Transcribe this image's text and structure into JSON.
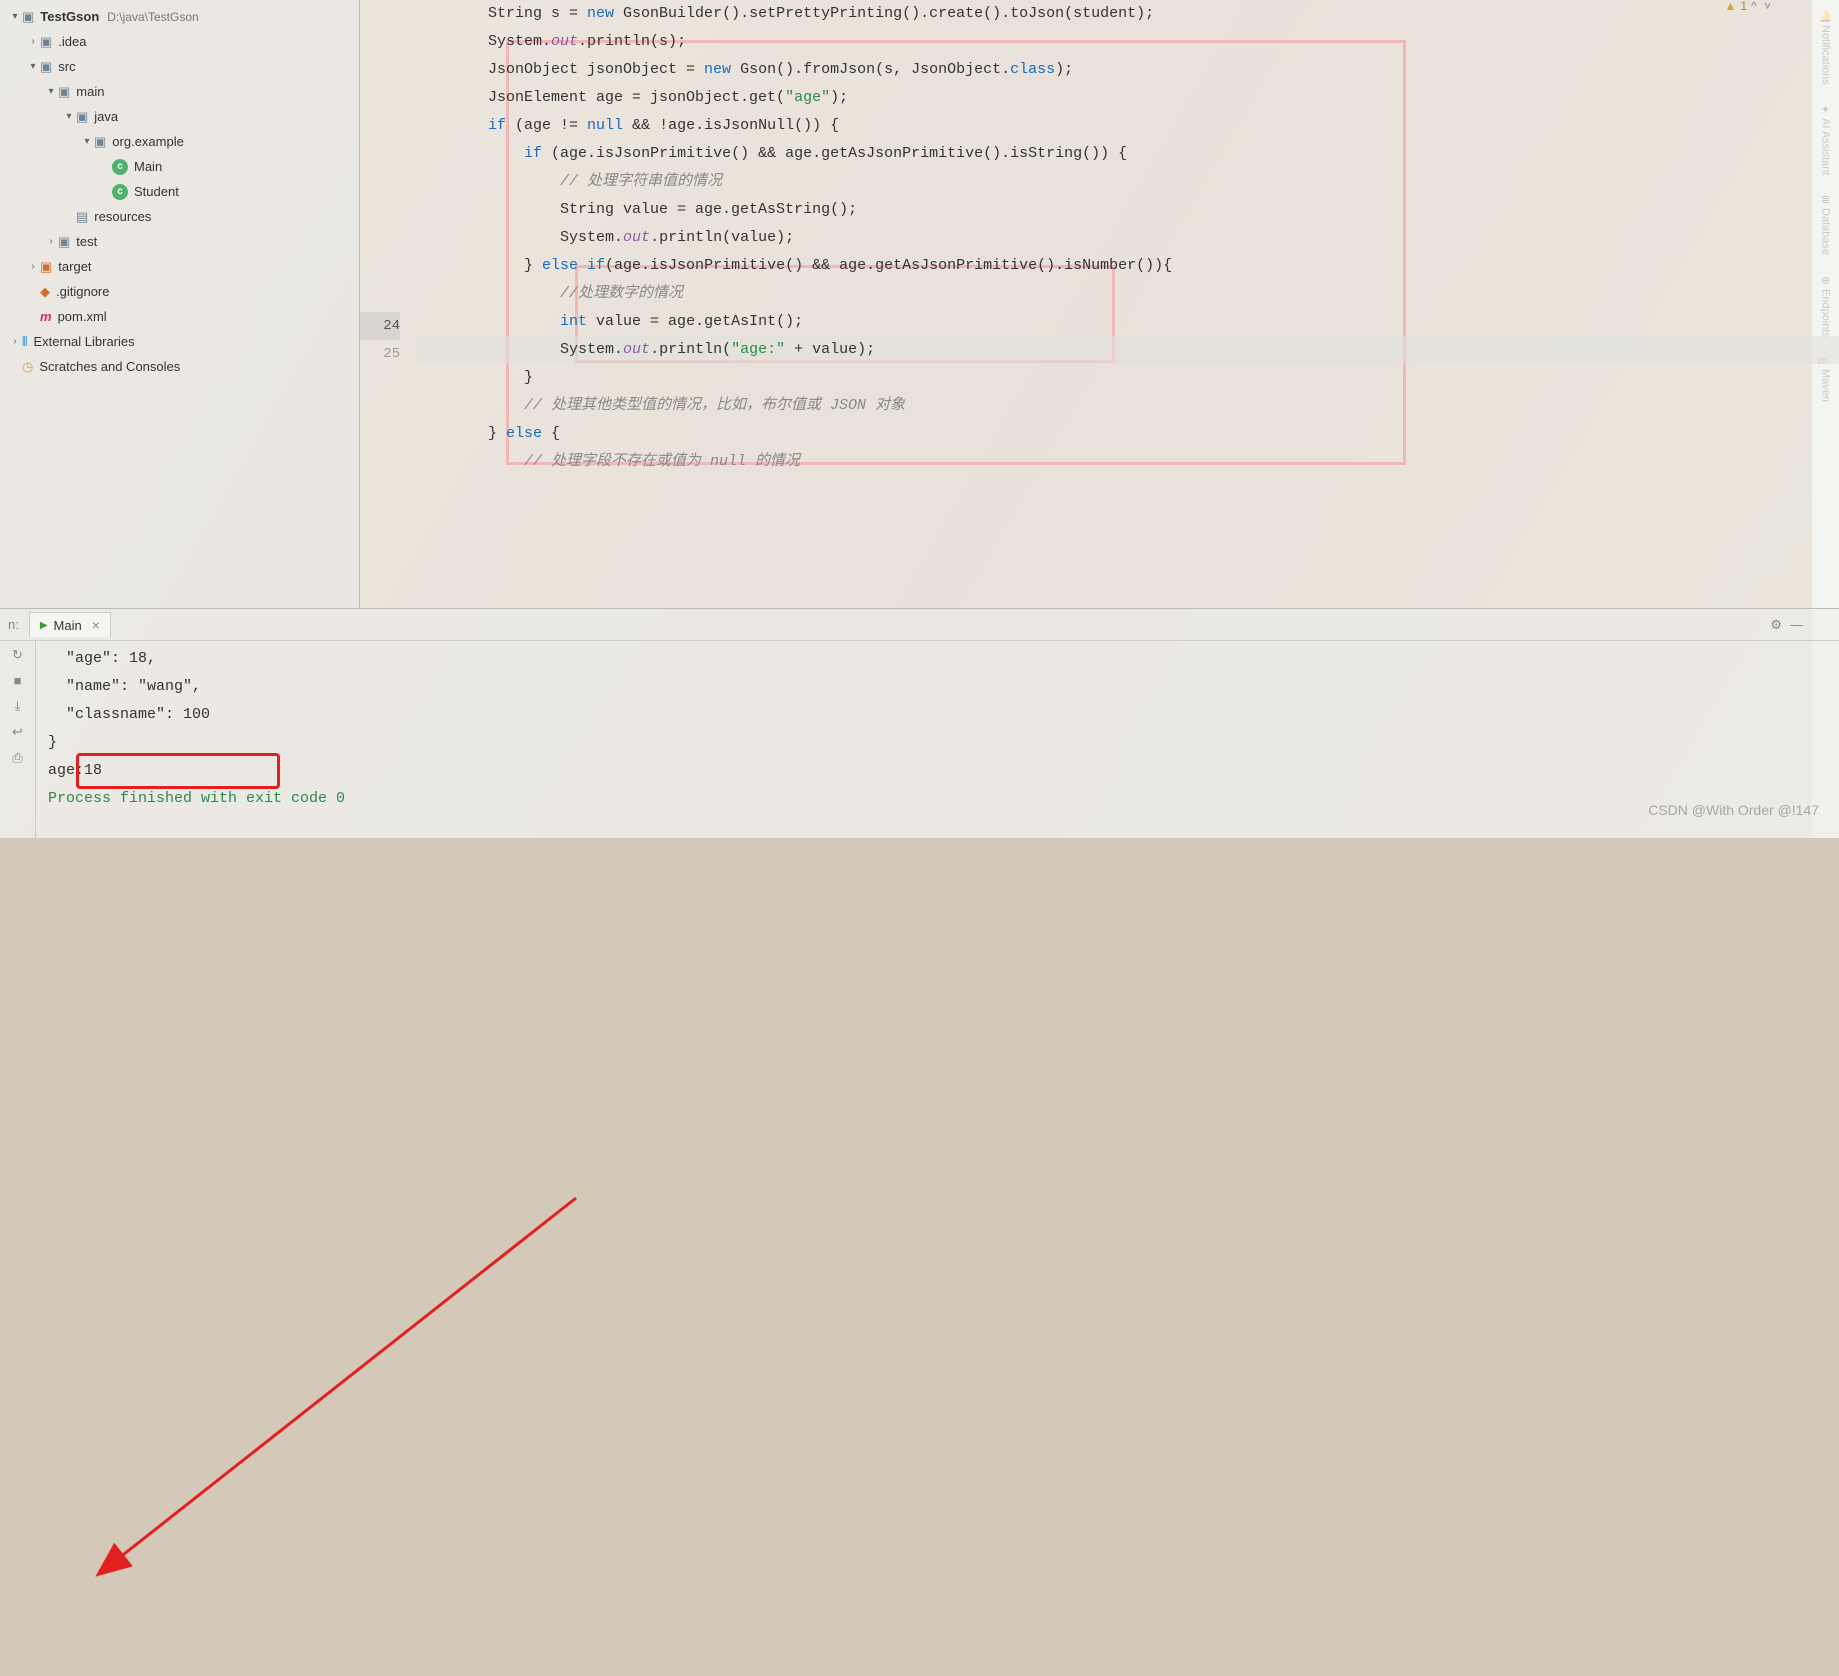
{
  "project": {
    "name": "TestGson",
    "path": "D:\\java\\TestGson"
  },
  "tree": {
    "idea": ".idea",
    "src": "src",
    "main": "main",
    "java": "java",
    "pkg": "org.example",
    "main_cls": "Main",
    "student_cls": "Student",
    "resources": "resources",
    "test": "test",
    "target": "target",
    "gitignore": ".gitignore",
    "pom": "pom.xml",
    "ext_lib": "External Libraries",
    "scratch": "Scratches and Consoles"
  },
  "warning": {
    "count": "1"
  },
  "gutter": {
    "l24": "24",
    "l25": "25"
  },
  "run": {
    "tab": "Main",
    "out1": "  \"age\": 18,",
    "out2": "  \"name\": \"wang\",",
    "out3": "  \"classname\": 100",
    "out4": "}",
    "out5": "age:18",
    "out6": "",
    "exit": "Process finished with exit code 0"
  },
  "right_tools": {
    "notif": "Notifications",
    "ai": "AI Assistant",
    "db": "Database",
    "ep": "Endpoints",
    "mvn": "Maven"
  },
  "watermark": "CSDN @With Order @!147",
  "code": {
    "l0_a": "        String s = ",
    "l0_kw": "new",
    "l0_b": " GsonBuilder().setPrettyPrinting().create().toJson(student);",
    "l1_a": "        System.",
    "l1_f": "out",
    "l1_b": ".println(s);",
    "l2_a": "        JsonObject jsonObject = ",
    "l2_kw": "new",
    "l2_b": " Gson().fromJson(s, JsonObject.",
    "l2_kw2": "class",
    "l2_c": ");",
    "l3_a": "        JsonElement age = jsonObject.get(",
    "l3_s": "\"age\"",
    "l3_b": ");",
    "l4_kw": "if",
    "l4_a": " (age != ",
    "l4_kw2": "null",
    "l4_b": " && !age.isJsonNull()) {",
    "l5_kw": "if",
    "l5_a": " (age.isJsonPrimitive() && age.getAsJsonPrimitive().isString()) {",
    "l6": "                // 处理字符串值的情况",
    "l7_a": "                String value = age.getAsString();",
    "l8_a": "                System.",
    "l8_f": "out",
    "l8_b": ".println(value);",
    "l9_a": "            } ",
    "l9_kw": "else if",
    "l9_b": "(age.isJsonPrimitive() && age.getAsJsonPrimitive().isNumber()){",
    "l10": "                //处理数字的情况",
    "l11_kw": "int",
    "l11_a": " value = age.getAsInt();",
    "l12_a": "                System.",
    "l12_f": "out",
    "l12_b": ".println(",
    "l12_s": "\"age:\"",
    "l12_c": " + value);",
    "l13": "            }",
    "l14": "            // 处理其他类型值的情况，比如，布尔值或 JSON 对象",
    "l15_a": "        } ",
    "l15_kw": "else",
    "l15_b": " {",
    "l16": "            // 处理字段不存在或值为 null 的情况"
  }
}
